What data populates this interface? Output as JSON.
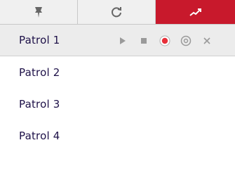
{
  "tabs": [
    {
      "icon": "pin-icon",
      "active": false
    },
    {
      "icon": "refresh-icon",
      "active": false
    },
    {
      "icon": "trend-chart-icon",
      "active": true
    }
  ],
  "rows": [
    {
      "label": "Patrol 1",
      "selected": true
    },
    {
      "label": "Patrol 2",
      "selected": false
    },
    {
      "label": "Patrol 3",
      "selected": false
    },
    {
      "label": "Patrol 4",
      "selected": false
    }
  ],
  "row_actions": [
    "play-icon",
    "stop-icon",
    "record-icon",
    "settings-icon",
    "delete-icon"
  ],
  "colors": {
    "accent": "#c8192c",
    "record": "#e8303a",
    "text": "#1e1148"
  }
}
